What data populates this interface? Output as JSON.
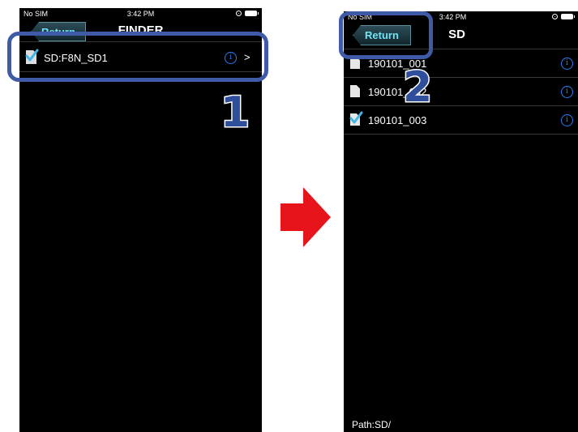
{
  "left_screen": {
    "status": {
      "carrier": "No SIM",
      "time": "3:42 PM"
    },
    "nav": {
      "back_label": "Return",
      "title": "FINDER"
    },
    "rows": [
      {
        "label": "SD:F8N_SD1",
        "info": "i",
        "chevron": ">"
      }
    ]
  },
  "right_screen": {
    "status": {
      "carrier": "No SIM",
      "time": "3:42 PM"
    },
    "nav": {
      "back_label": "Return",
      "title": "SD"
    },
    "rows": [
      {
        "label": "190101_001",
        "info": "i"
      },
      {
        "label": "190101_002",
        "info": "i"
      },
      {
        "label": "190101_003",
        "info": "i"
      }
    ],
    "path": "Path:SD/"
  },
  "steps": {
    "step1": "1",
    "step2": "2"
  },
  "colors": {
    "highlight": "#3f5ba8",
    "arrow": "#e8141c",
    "info_blue": "#2f7cf6",
    "back_text": "#6fe3f3"
  },
  "icons": [
    "checkbox-icon",
    "sd-card-icon",
    "file-icon",
    "info-icon",
    "chevron-right-icon",
    "back-arrow-icon",
    "lock-icon",
    "battery-icon",
    "right-arrow-icon"
  ]
}
